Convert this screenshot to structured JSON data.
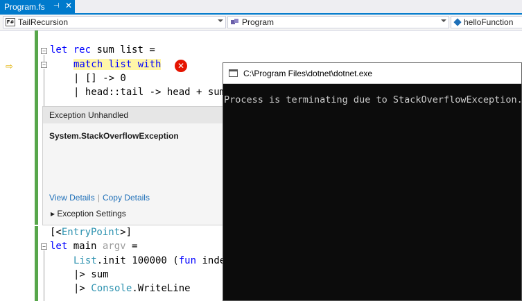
{
  "tab": {
    "title": "Program.fs",
    "pin": "⊣",
    "close": "✕"
  },
  "navbar": {
    "project": "TailRecursion",
    "module": "Program",
    "member": "helloFunction"
  },
  "icons": {
    "project": "fsharp-file-icon",
    "module": "class-icon",
    "member": "cube-icon",
    "pointer": "instruction-pointer-icon",
    "error": "error-icon"
  },
  "code": {
    "l1": {
      "kw1": "let",
      "kw2": "rec",
      "rest": " sum list ="
    },
    "l2": {
      "text": "match list with"
    },
    "l3": {
      "a": "| [] -> 0"
    },
    "l4": {
      "a": "| head::tail -> head + sum"
    },
    "l5": {
      "a": "[<",
      "b": "EntryPoint",
      "c": ">]"
    },
    "l6": {
      "kw": "let",
      "a": " main ",
      "b": "argv",
      "c": " ="
    },
    "l7": {
      "a": "List",
      "b": ".init 100000 (",
      "c": "fun",
      "d": " inde"
    },
    "l8": {
      "a": "|> sum"
    },
    "l9": {
      "a": "|> ",
      "b": "Console",
      "c": ".WriteLine"
    }
  },
  "exception": {
    "header": "Exception Unhandled",
    "type": "System.StackOverflowException",
    "view_details": "View Details",
    "separator": "|",
    "copy_details": "Copy Details",
    "settings": "Exception Settings",
    "settings_arrow": "▸"
  },
  "console": {
    "title": "C:\\Program Files\\dotnet\\dotnet.exe",
    "output": "Process is terminating due to StackOverflowException."
  },
  "colors": {
    "accent": "#007acc",
    "keyword": "#0000ff",
    "type": "#2b91af",
    "highlight": "#fff6a8",
    "error": "#e51400",
    "console_bg": "#0c0c0c"
  }
}
